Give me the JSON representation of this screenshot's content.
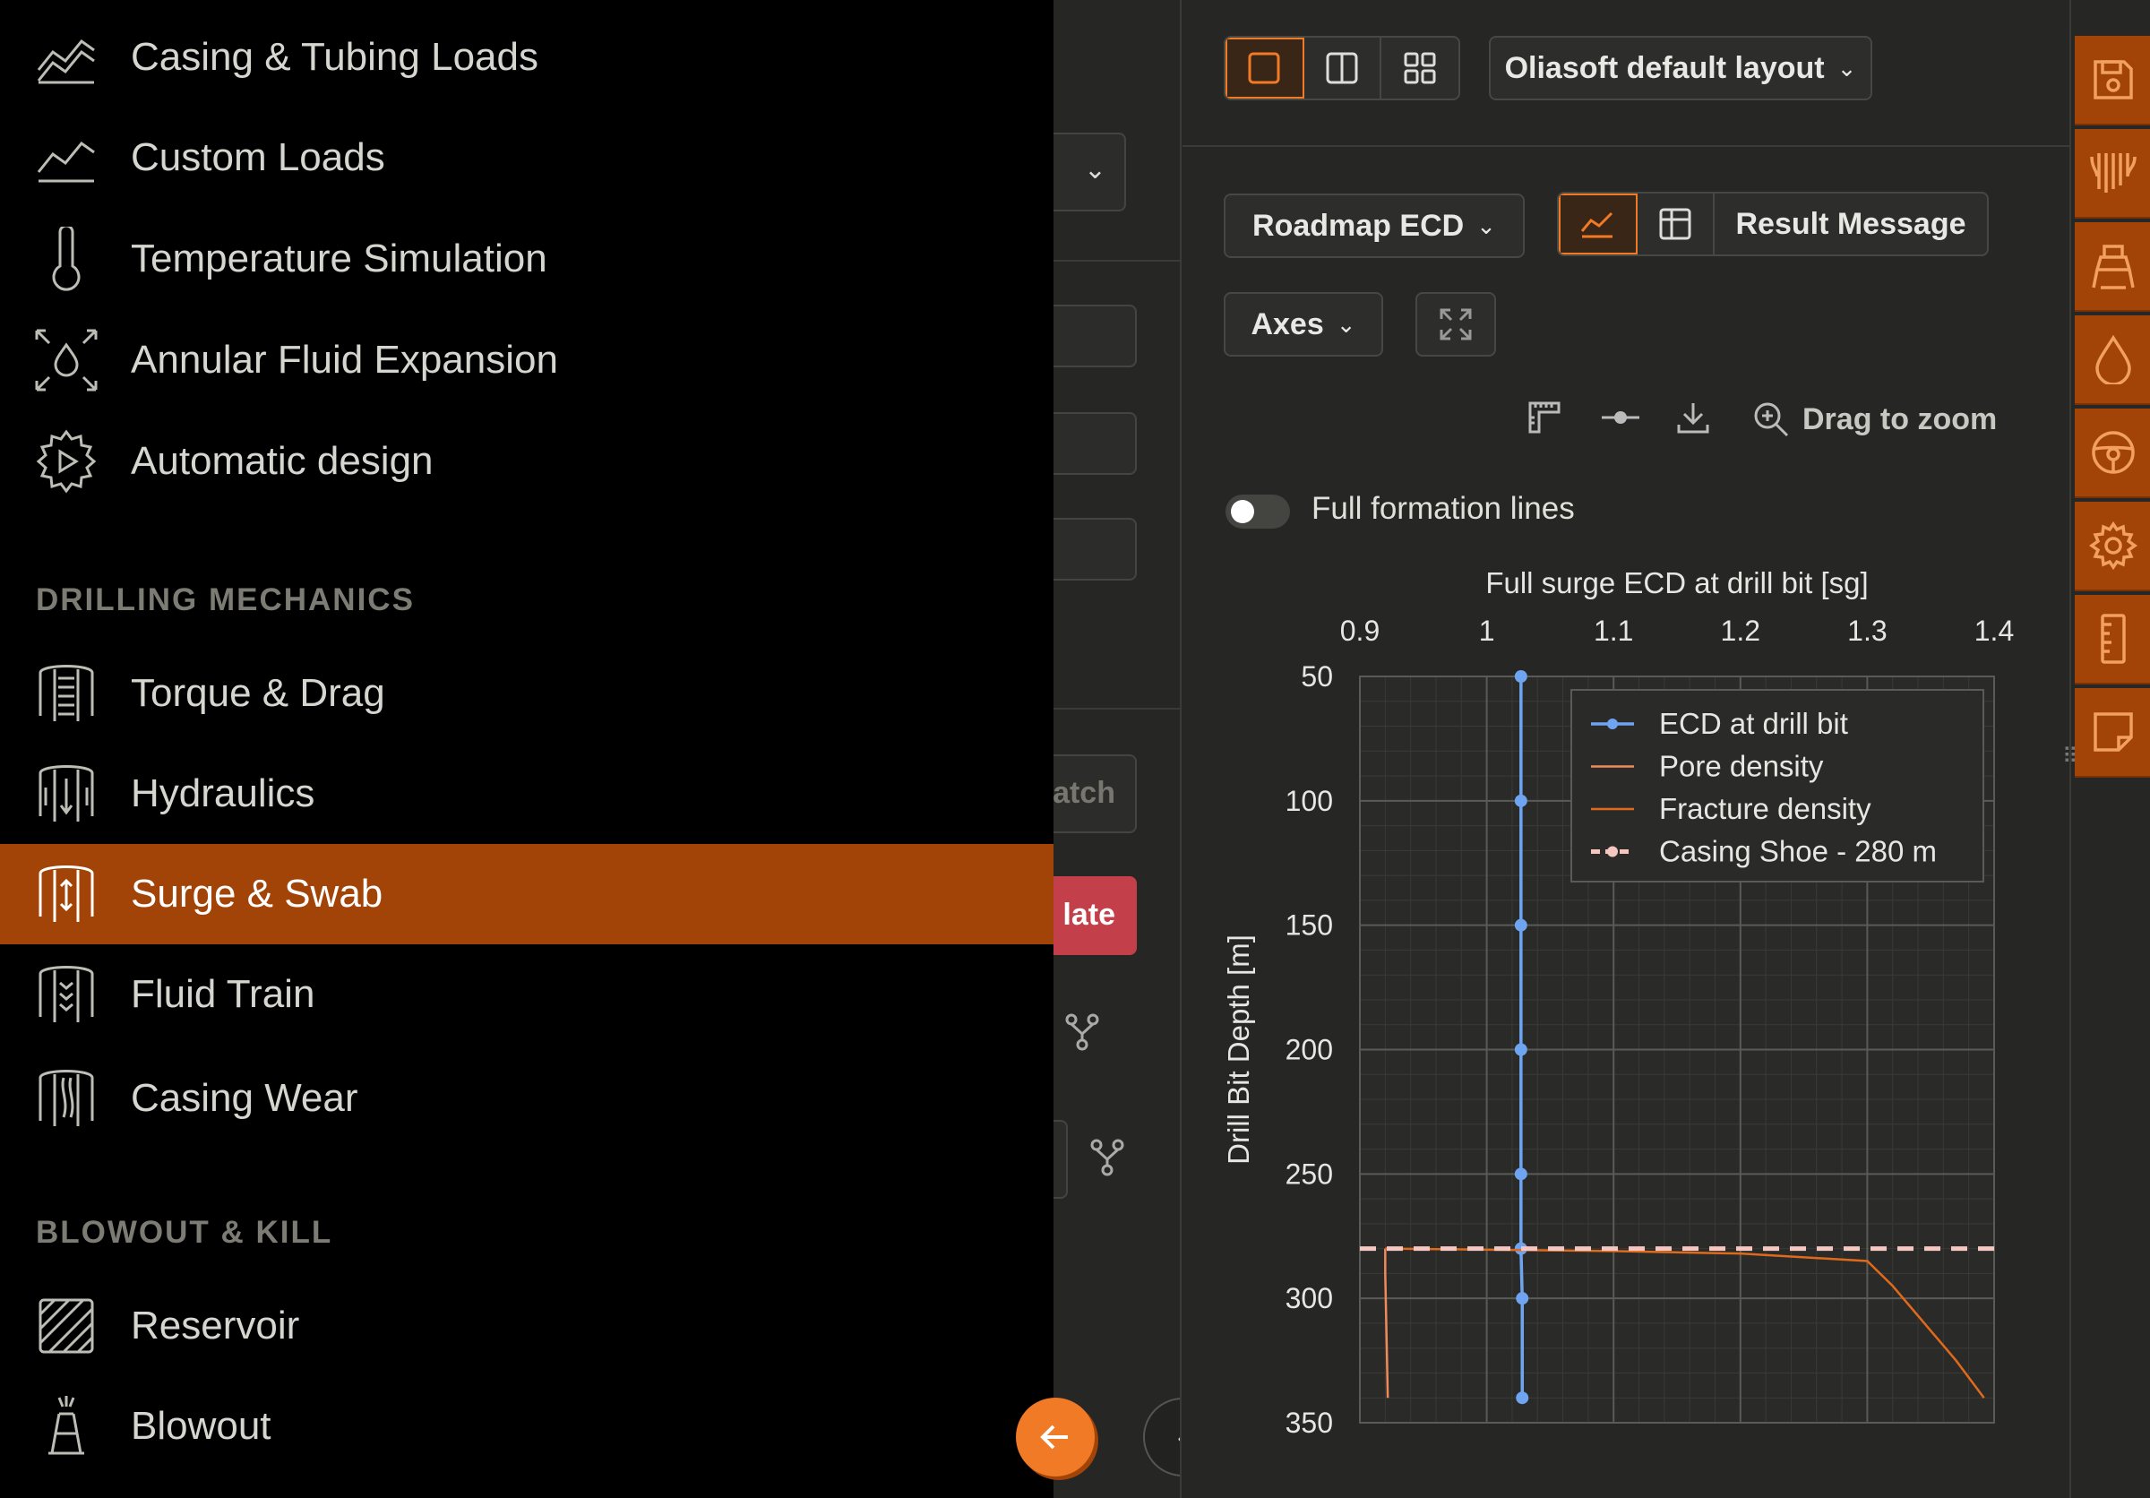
{
  "sidebar": {
    "items_top": [
      {
        "label": "Casing & Tubing Loads",
        "icon": "area-chart-icon"
      },
      {
        "label": "Custom Loads",
        "icon": "line-chart-icon"
      },
      {
        "label": "Temperature Simulation",
        "icon": "thermometer-icon"
      },
      {
        "label": "Annular Fluid Expansion",
        "icon": "fluid-expansion-icon"
      },
      {
        "label": "Automatic design",
        "icon": "play-gear-icon"
      }
    ],
    "section_drilling": "DRILLING MECHANICS",
    "items_drilling": [
      {
        "label": "Torque & Drag",
        "icon": "torque-drag-icon"
      },
      {
        "label": "Hydraulics",
        "icon": "hydraulics-icon"
      },
      {
        "label": "Surge & Swab",
        "icon": "surge-swab-icon",
        "active": true
      },
      {
        "label": "Fluid Train",
        "icon": "fluid-train-icon"
      },
      {
        "label": "Casing Wear",
        "icon": "casing-wear-icon"
      }
    ],
    "section_blowout": "BLOWOUT & KILL",
    "items_blowout": [
      {
        "label": "Reservoir",
        "icon": "reservoir-icon"
      },
      {
        "label": "Blowout",
        "icon": "blowout-icon"
      }
    ]
  },
  "mid_panel": {
    "partial_button_text": "atch",
    "calculate_partial": "late"
  },
  "toolbar": {
    "layout_label": "Oliasoft default layout",
    "chart_select": "Roadmap ECD",
    "result_message": "Result Message",
    "axes_label": "Axes",
    "drag_to_zoom": "Drag to zoom",
    "full_formation_lines": "Full formation lines"
  },
  "colors": {
    "accent": "#f07a26",
    "sidebar_active": "#a24307",
    "ecd_line": "#6fa4f0",
    "pore_line": "#f08a5a",
    "fracture_line": "#e06a1c",
    "casing_shoe": "#f6c6c0",
    "danger": "#c3404b"
  },
  "chart_data": {
    "type": "line",
    "title": "Full surge ECD at drill bit [sg]",
    "xlabel": "Full surge ECD at drill bit [sg]",
    "ylabel": "Drill Bit Depth [m]",
    "xlim": [
      0.9,
      1.4
    ],
    "ylim": [
      50,
      350
    ],
    "y_inverted": true,
    "x_axis_position": "top",
    "xticks": [
      "0.9",
      "1",
      "1.1",
      "1.2",
      "1.3",
      "1.4"
    ],
    "yticks": [
      "50",
      "100",
      "150",
      "200",
      "250",
      "300",
      "350"
    ],
    "grid": true,
    "legend_position": "top-right",
    "series": [
      {
        "name": "ECD at drill bit",
        "style": "line-markers",
        "x": [
          1.027,
          1.027,
          1.027,
          1.027,
          1.027,
          1.027,
          1.028,
          1.028
        ],
        "y": [
          50,
          100,
          150,
          200,
          250,
          280,
          300,
          340
        ]
      },
      {
        "name": "Pore density",
        "style": "line",
        "x": [
          0.92,
          0.92,
          0.922
        ],
        "y": [
          280,
          290,
          340
        ]
      },
      {
        "name": "Fracture density",
        "style": "line",
        "x": [
          0.92,
          1.1,
          1.2,
          1.3,
          1.32,
          1.345,
          1.37,
          1.392
        ],
        "y": [
          280,
          281,
          282,
          285,
          295,
          310,
          325,
          340
        ]
      },
      {
        "name": "Casing Shoe - 280 m",
        "style": "dashed",
        "y_const": 280
      }
    ]
  }
}
